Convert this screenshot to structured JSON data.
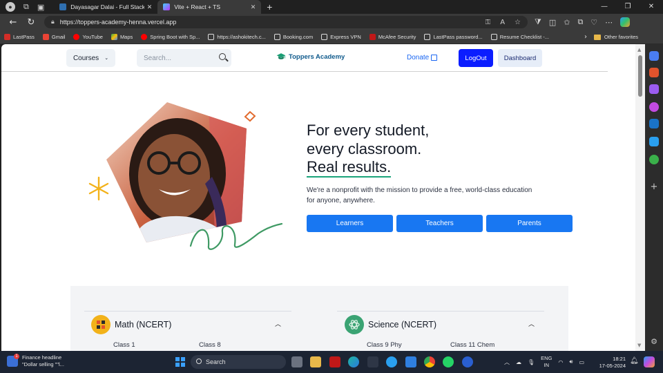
{
  "browser": {
    "tabs": [
      {
        "title": "Dayasagar Dalai - Full Stack Developer",
        "active": false,
        "favicon_color": "#2f6fb0"
      },
      {
        "title": "Vite + React + TS",
        "active": true,
        "favicon_color": "#a46bff"
      }
    ],
    "new_tab_glyph": "+",
    "close_glyph": "✕",
    "url": "https://toppers-academy-henna.vercel.app",
    "bookmarks": [
      {
        "label": "LastPass",
        "color": "#d32d27"
      },
      {
        "label": "Gmail",
        "color": "#ea4335"
      },
      {
        "label": "YouTube",
        "color": "#ff0000"
      },
      {
        "label": "Maps",
        "color": "#34a853"
      },
      {
        "label": "Spring Boot with Sp...",
        "color": "#ff0000"
      },
      {
        "label": "https://ashokitech.c...",
        "color": "#e6e6e6"
      },
      {
        "label": "Booking.com",
        "color": "#e6e6e6"
      },
      {
        "label": "Express VPN",
        "color": "#e6e6e6"
      },
      {
        "label": "McAfee Security",
        "color": "#c01818"
      },
      {
        "label": "LastPass password...",
        "color": "#e6e6e6"
      },
      {
        "label": "Resume Checklist -...",
        "color": "#e6e6e6"
      }
    ],
    "other_favorites": "Other favorites"
  },
  "header": {
    "courses_label": "Courses",
    "search_placeholder": "Search...",
    "logo_text": "Toppers Academy",
    "donate_label": "Donate",
    "logout_label": "LogOut",
    "dashboard_label": "Dashboard"
  },
  "hero": {
    "title_line1": "For every student,",
    "title_line2": "every classroom.",
    "title_line3": "Real results.",
    "subtitle": "We're a nonprofit with the mission to provide a free, world-class education for anyone, anywhere.",
    "buttons": [
      "Learners",
      "Teachers",
      "Parents"
    ]
  },
  "subjects": [
    {
      "title": "Math (NCERT)",
      "items": [
        "Class 1",
        "Class 8"
      ],
      "icon_color": "#f2b21a"
    },
    {
      "title": "Science (NCERT)",
      "items": [
        "Class 9 Phy",
        "Class 11 Chem"
      ],
      "icon_color": "#3aa373"
    }
  ],
  "taskbar": {
    "news_title": "Finance headline",
    "news_sub": "\"Dollar selling \"\"l...",
    "news_badge": "1",
    "search_label": "Search",
    "lang_line1": "ENG",
    "lang_line2": "IN",
    "time": "18:21",
    "date": "17-05-2024"
  },
  "colors": {
    "primary_button": "#1877f2",
    "logout_bg": "#0b1dff",
    "link": "#1865f2",
    "accent_underline": "#1aa37a"
  }
}
